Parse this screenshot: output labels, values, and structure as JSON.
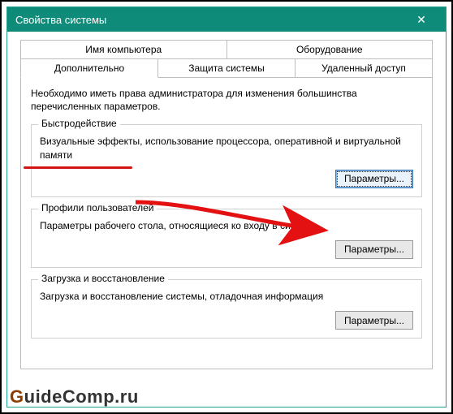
{
  "window": {
    "title": "Свойства системы",
    "close_glyph": "✕"
  },
  "tabs": {
    "row1": [
      {
        "label": "Имя компьютера"
      },
      {
        "label": "Оборудование"
      }
    ],
    "row2": [
      {
        "label": "Дополнительно",
        "active": true
      },
      {
        "label": "Защита системы"
      },
      {
        "label": "Удаленный доступ"
      }
    ]
  },
  "intro": "Необходимо иметь права администратора для изменения большинства перечисленных параметров.",
  "groups": {
    "performance": {
      "legend": "Быстродействие",
      "desc": "Визуальные эффекты, использование процессора, оперативной и виртуальной памяти",
      "button": "Параметры..."
    },
    "profiles": {
      "legend": "Профили пользователей",
      "desc": "Параметры рабочего стола, относящиеся ко входу в систему",
      "button": "Параметры..."
    },
    "startup": {
      "legend": "Загрузка и восстановление",
      "desc": "Загрузка и восстановление системы, отладочная информация",
      "button": "Параметры..."
    }
  },
  "watermark": {
    "first": "G",
    "rest": "uideComp.ru"
  },
  "annotation": {
    "underline_color": "#d31414",
    "arrow_color": "#e31111"
  }
}
